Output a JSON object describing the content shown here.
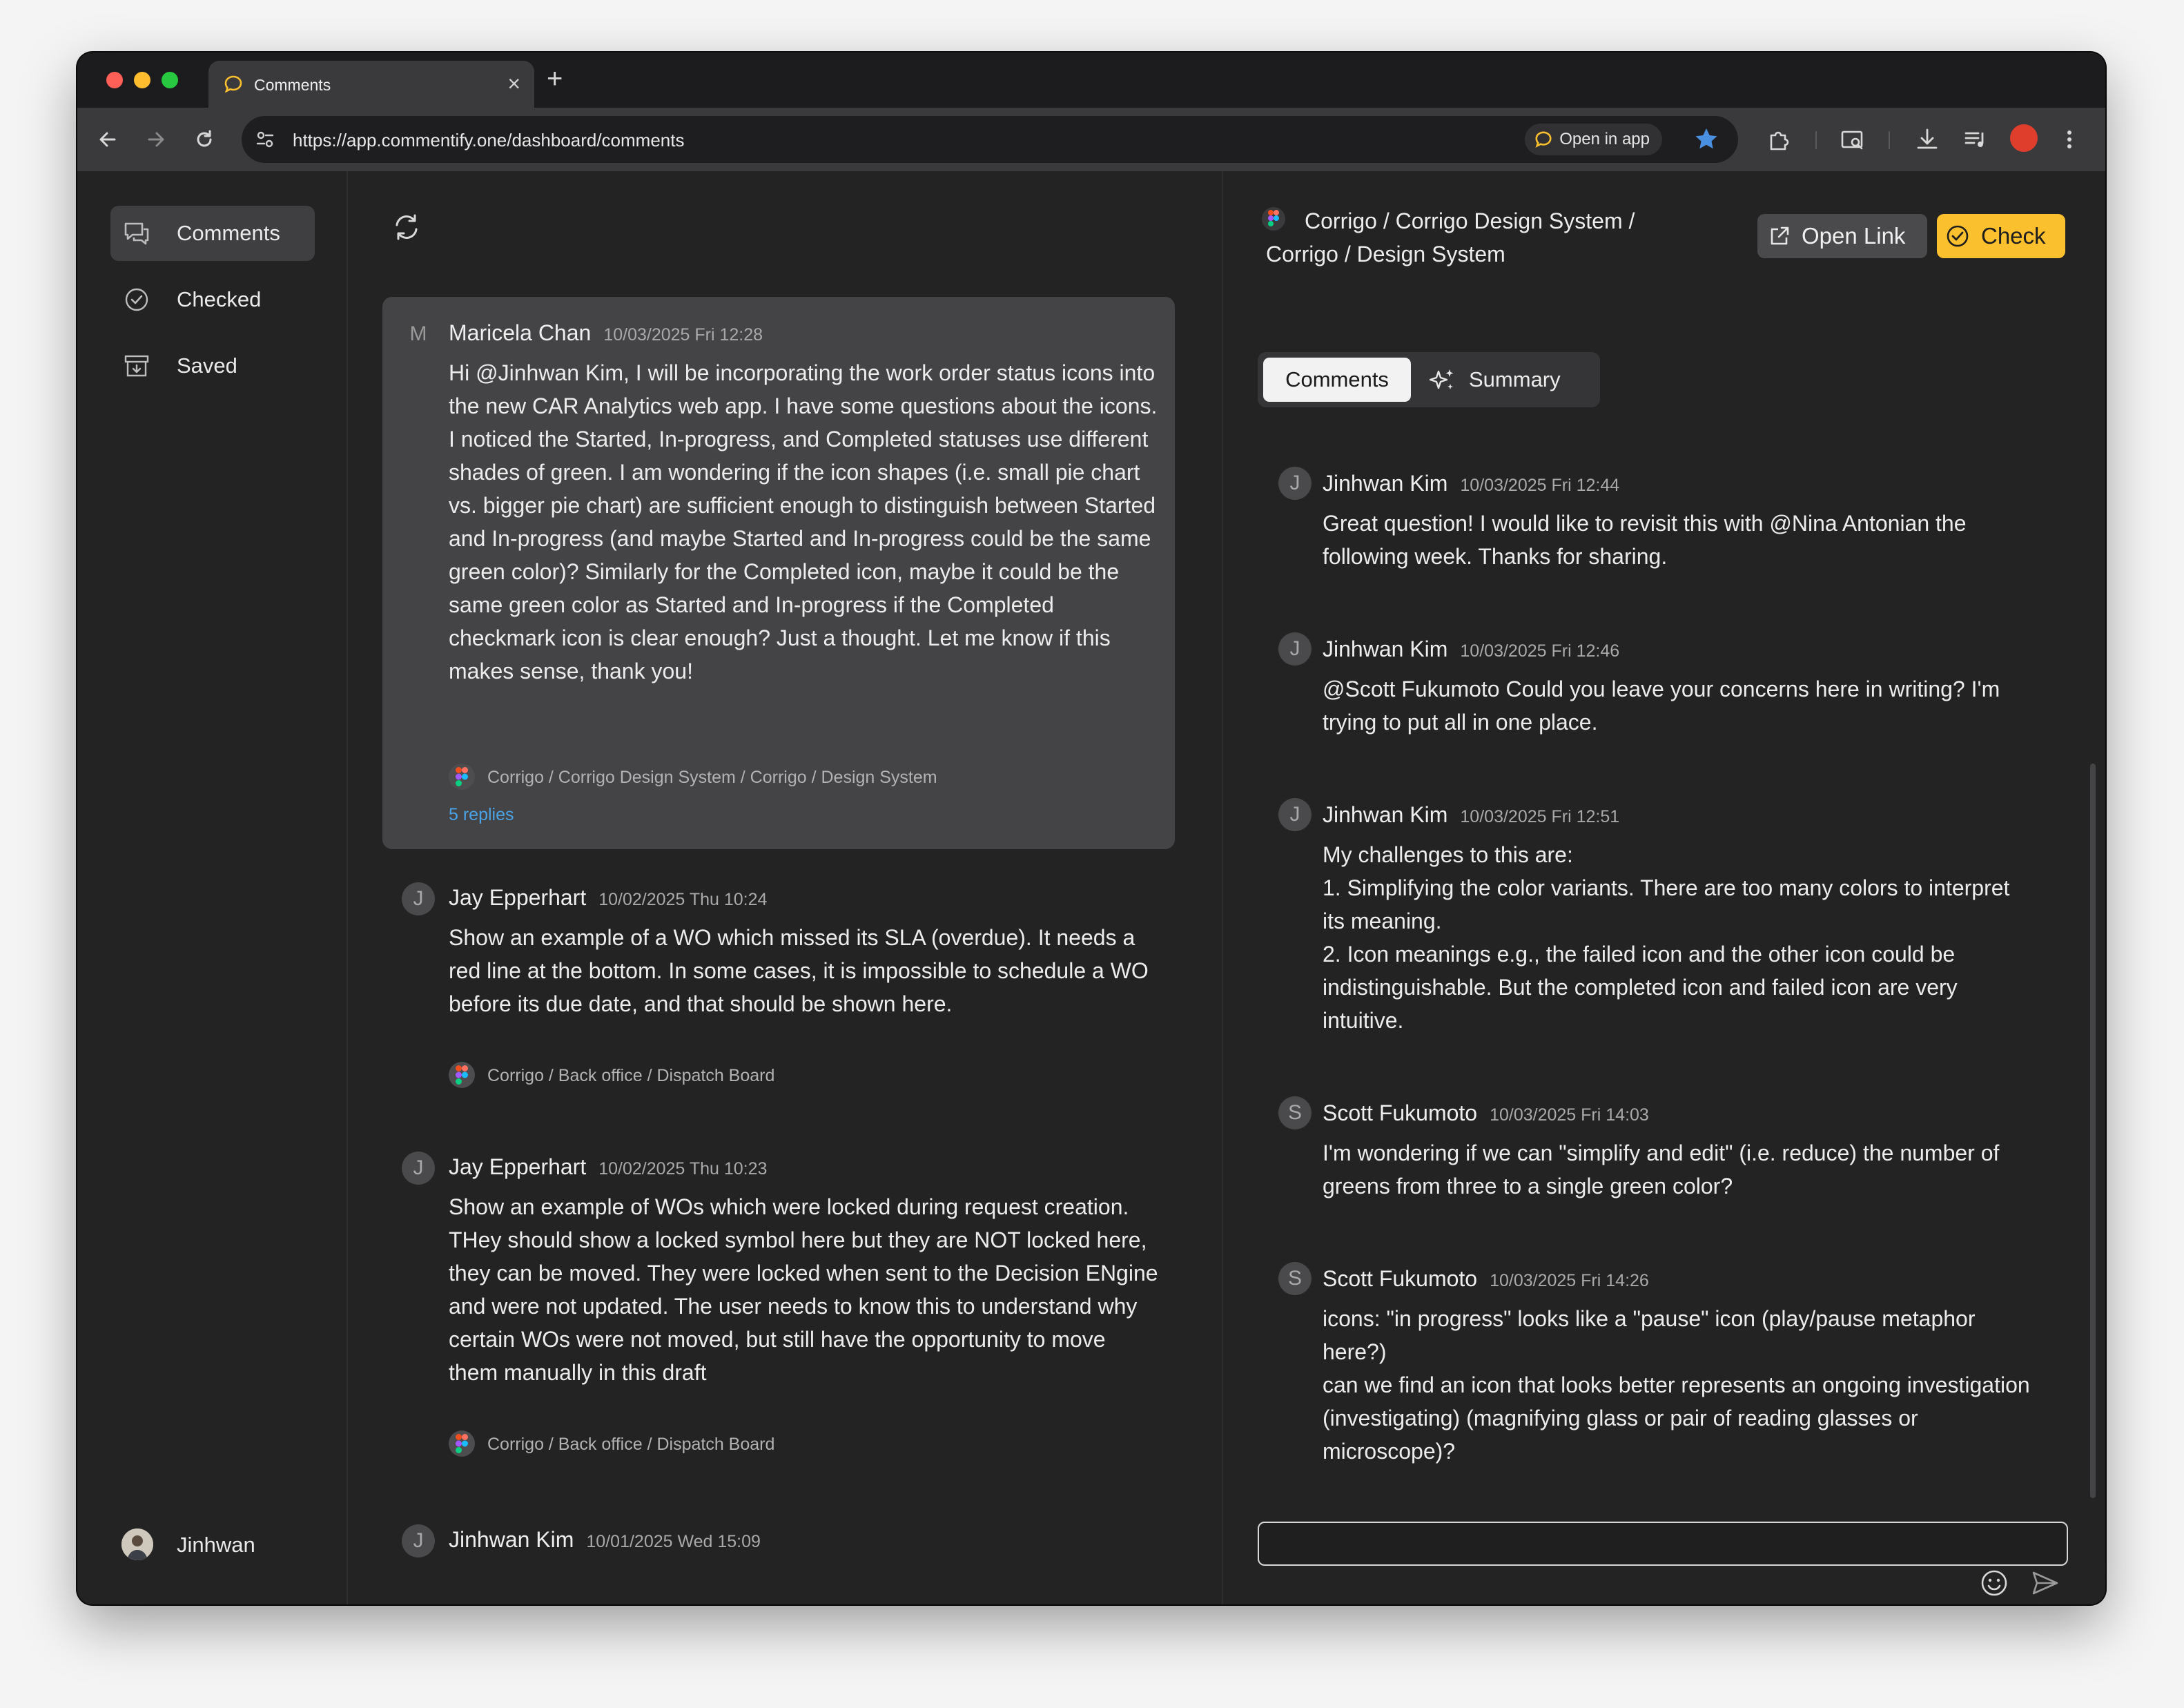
{
  "browser": {
    "tab_title": "Comments",
    "tab_close": "×",
    "new_tab": "+",
    "url": "https://app.commentify.one/dashboard/comments",
    "open_in_app": "Open in app"
  },
  "sidebar": {
    "items": [
      {
        "label": "Comments",
        "icon": "comments-icon",
        "active": true
      },
      {
        "label": "Checked",
        "icon": "check-circle-icon",
        "active": false
      },
      {
        "label": "Saved",
        "icon": "archive-icon",
        "active": false
      }
    ],
    "user": {
      "name": "Jinhwan"
    }
  },
  "feed": {
    "comments": [
      {
        "initial": "M",
        "author": "Maricela Chan",
        "time": "10/03/2025 Fri 12:28",
        "body_lines": [
          "Hi @Jinhwan Kim, I will be incorporating the work order status icons into the new CAR Analytics web app. I have some questions about the icons.",
          "I noticed the Started, In-progress, and Completed statuses use different shades of green. I am wondering if the icon shapes (i.e. small pie chart vs. bigger pie chart) are sufficient enough to distinguish between Started and In-progress (and maybe Started and In-progress could be the same green color)? Similarly for the Completed icon, maybe it could be the same green color as Started and In-progress if the Completed checkmark icon is clear enough? Just a thought. Let me know if this makes sense, thank you!"
        ],
        "path": "Corrigo / Corrigo Design System / Corrigo / Design System",
        "replies": "5 replies"
      },
      {
        "initial": "J",
        "author": "Jay Epperhart",
        "time": "10/02/2025 Thu 10:24",
        "body": "Show an example of a WO which missed its SLA (overdue). It needs a red line at the bottom. In some cases, it is impossible to schedule a WO before its due date, and that should be shown here.",
        "path": "Corrigo / Back office / Dispatch Board"
      },
      {
        "initial": "J",
        "author": "Jay Epperhart",
        "time": "10/02/2025 Thu 10:23",
        "body": "Show an example of WOs which were locked during request creation. THey should show a locked symbol here but they are NOT locked here, they can be moved. They were locked when sent to the Decision ENgine and were not updated. The user needs to know this to understand why certain WOs were not moved, but still have the opportunity to move them manually in this draft",
        "path": "Corrigo / Back office / Dispatch Board"
      },
      {
        "initial": "J",
        "author": "Jinhwan Kim",
        "time": "10/01/2025 Wed 15:09"
      }
    ]
  },
  "detail": {
    "path": "Corrigo / Corrigo Design System / Corrigo / Design System",
    "open_link": "Open Link",
    "check": "Check",
    "tabs": {
      "comments": "Comments",
      "summary": "Summary"
    },
    "thread": [
      {
        "initial": "J",
        "author": "Jinhwan Kim",
        "time": "10/03/2025 Fri 12:44",
        "body": "Great question! I would like to revisit this with @Nina Antonian the following week. Thanks for sharing."
      },
      {
        "initial": "J",
        "author": "Jinhwan Kim",
        "time": "10/03/2025 Fri 12:46",
        "body": "@Scott Fukumoto Could you leave your concerns here in writing? I'm trying to put all in one place."
      },
      {
        "initial": "J",
        "author": "Jinhwan Kim",
        "time": "10/03/2025 Fri 12:51",
        "body_lines": [
          "My challenges to this are:",
          "1. Simplifying the color variants. There are too many colors to interpret its meaning.",
          "2. Icon meanings e.g., the failed icon and the other icon could be indistinguishable. But the completed icon and failed icon are very intuitive."
        ]
      },
      {
        "initial": "S",
        "author": "Scott Fukumoto",
        "time": "10/03/2025 Fri 14:03",
        "body": "I'm wondering if we can \"simplify and edit\" (i.e. reduce) the number of greens from three to a single green color?"
      },
      {
        "initial": "S",
        "author": "Scott Fukumoto",
        "time": "10/03/2025 Fri 14:26",
        "body_lines": [
          "icons: \"in progress\" looks like a \"pause\" icon (play/pause metaphor here?)",
          "can we find an icon that looks better represents an ongoing investigation (investigating) (magnifying glass or pair of reading glasses or microscope)?"
        ]
      }
    ],
    "reply_value": ""
  },
  "colors": {
    "accent_yellow": "#fbc02d",
    "link_blue": "#4aa3e6",
    "background": "#232323",
    "profile_red": "#e03e2d"
  }
}
